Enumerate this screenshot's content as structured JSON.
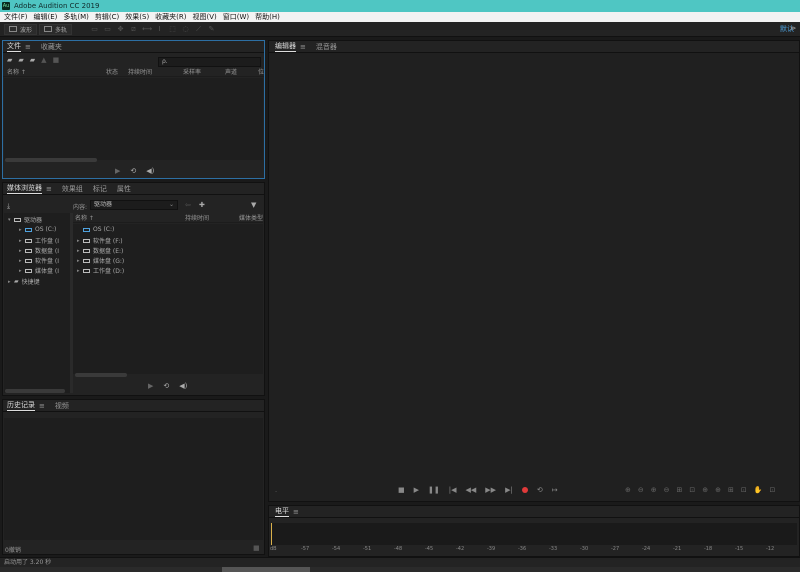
{
  "app": {
    "title": "Adobe Audition CC 2019",
    "icon_text": "Au"
  },
  "menu": [
    "文件(F)",
    "编辑(E)",
    "多轨(M)",
    "剪辑(C)",
    "效果(S)",
    "收藏夹(R)",
    "视图(V)",
    "窗口(W)",
    "帮助(H)"
  ],
  "toolbar": {
    "waveform_label": "波形",
    "multitrack_label": "多轨",
    "workspace_label": "默认"
  },
  "files_panel": {
    "tabs": [
      {
        "label": "文件"
      },
      {
        "label": "收藏夹"
      }
    ],
    "search_placeholder": "ρ.",
    "columns": [
      "名称 ↑",
      "状态",
      "持续时间",
      "采样率",
      "声道",
      "位"
    ]
  },
  "media_panel": {
    "tabs": [
      {
        "label": "媒体浏览器"
      },
      {
        "label": "效果组"
      },
      {
        "label": "标记"
      },
      {
        "label": "属性"
      }
    ],
    "content_label": "内容:",
    "content_value": "驱动器",
    "columns": [
      "名称 ↑",
      "持续时间",
      "媒体类型"
    ],
    "tree": [
      {
        "label": "驱动器",
        "level": 0
      },
      {
        "label": "OS (C:)",
        "level": 1
      },
      {
        "label": "工作盘 (D:)",
        "level": 1
      },
      {
        "label": "数据盘 (E:)",
        "level": 1
      },
      {
        "label": "软件盘 (F:)",
        "level": 1
      },
      {
        "label": "媒体盘 (G:)",
        "level": 1
      },
      {
        "label": "快捷键",
        "level": 0
      }
    ],
    "tree_visible": [
      "驱动器",
      "OS (C:)",
      "工作盘 (I",
      "数据盘 (I",
      "软件盘 (I",
      "媒体盘 (I",
      "快捷键"
    ],
    "files": [
      "OS (C:)",
      "软件盘 (F:)",
      "数据盘 (E:)",
      "媒体盘 (G:)",
      "工作盘 (D:)"
    ]
  },
  "history_panel": {
    "tabs": [
      {
        "label": "历史记录"
      },
      {
        "label": "视频"
      }
    ],
    "undo_label": "0撤销"
  },
  "editor_panel": {
    "tabs": [
      {
        "label": "编辑器"
      },
      {
        "label": "混音器"
      }
    ]
  },
  "level_panel": {
    "title": "电平",
    "ticks": [
      "dB",
      "-57",
      "-54",
      "-51",
      "-48",
      "-45",
      "-42",
      "-39",
      "-36",
      "-33",
      "-30",
      "-27",
      "-24",
      "-21",
      "-18",
      "-15",
      "-12"
    ]
  },
  "status": {
    "text": "启动用了 3.20 秒"
  }
}
